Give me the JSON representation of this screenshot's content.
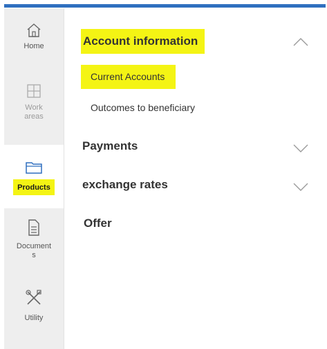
{
  "sidebar": {
    "items": [
      {
        "label": "Home",
        "icon": "home-icon"
      },
      {
        "label": "Work\nareas",
        "icon": "grid-icon"
      },
      {
        "label": "Products",
        "icon": "folder-icon"
      },
      {
        "label": "Document\ns",
        "icon": "document-icon"
      },
      {
        "label": "Utility",
        "icon": "tools-icon"
      }
    ]
  },
  "main": {
    "account_information": "Account information",
    "current_accounts": "Current Accounts",
    "outcomes_to_beneficiary": "Outcomes to beneficiary",
    "payments": "Payments",
    "exchange_rates": "exchange rates",
    "offer": "Offer"
  },
  "colors": {
    "highlight": "#f4f414",
    "top_line": "#2f6fbf",
    "sidebar_bg": "#eeeeee"
  }
}
